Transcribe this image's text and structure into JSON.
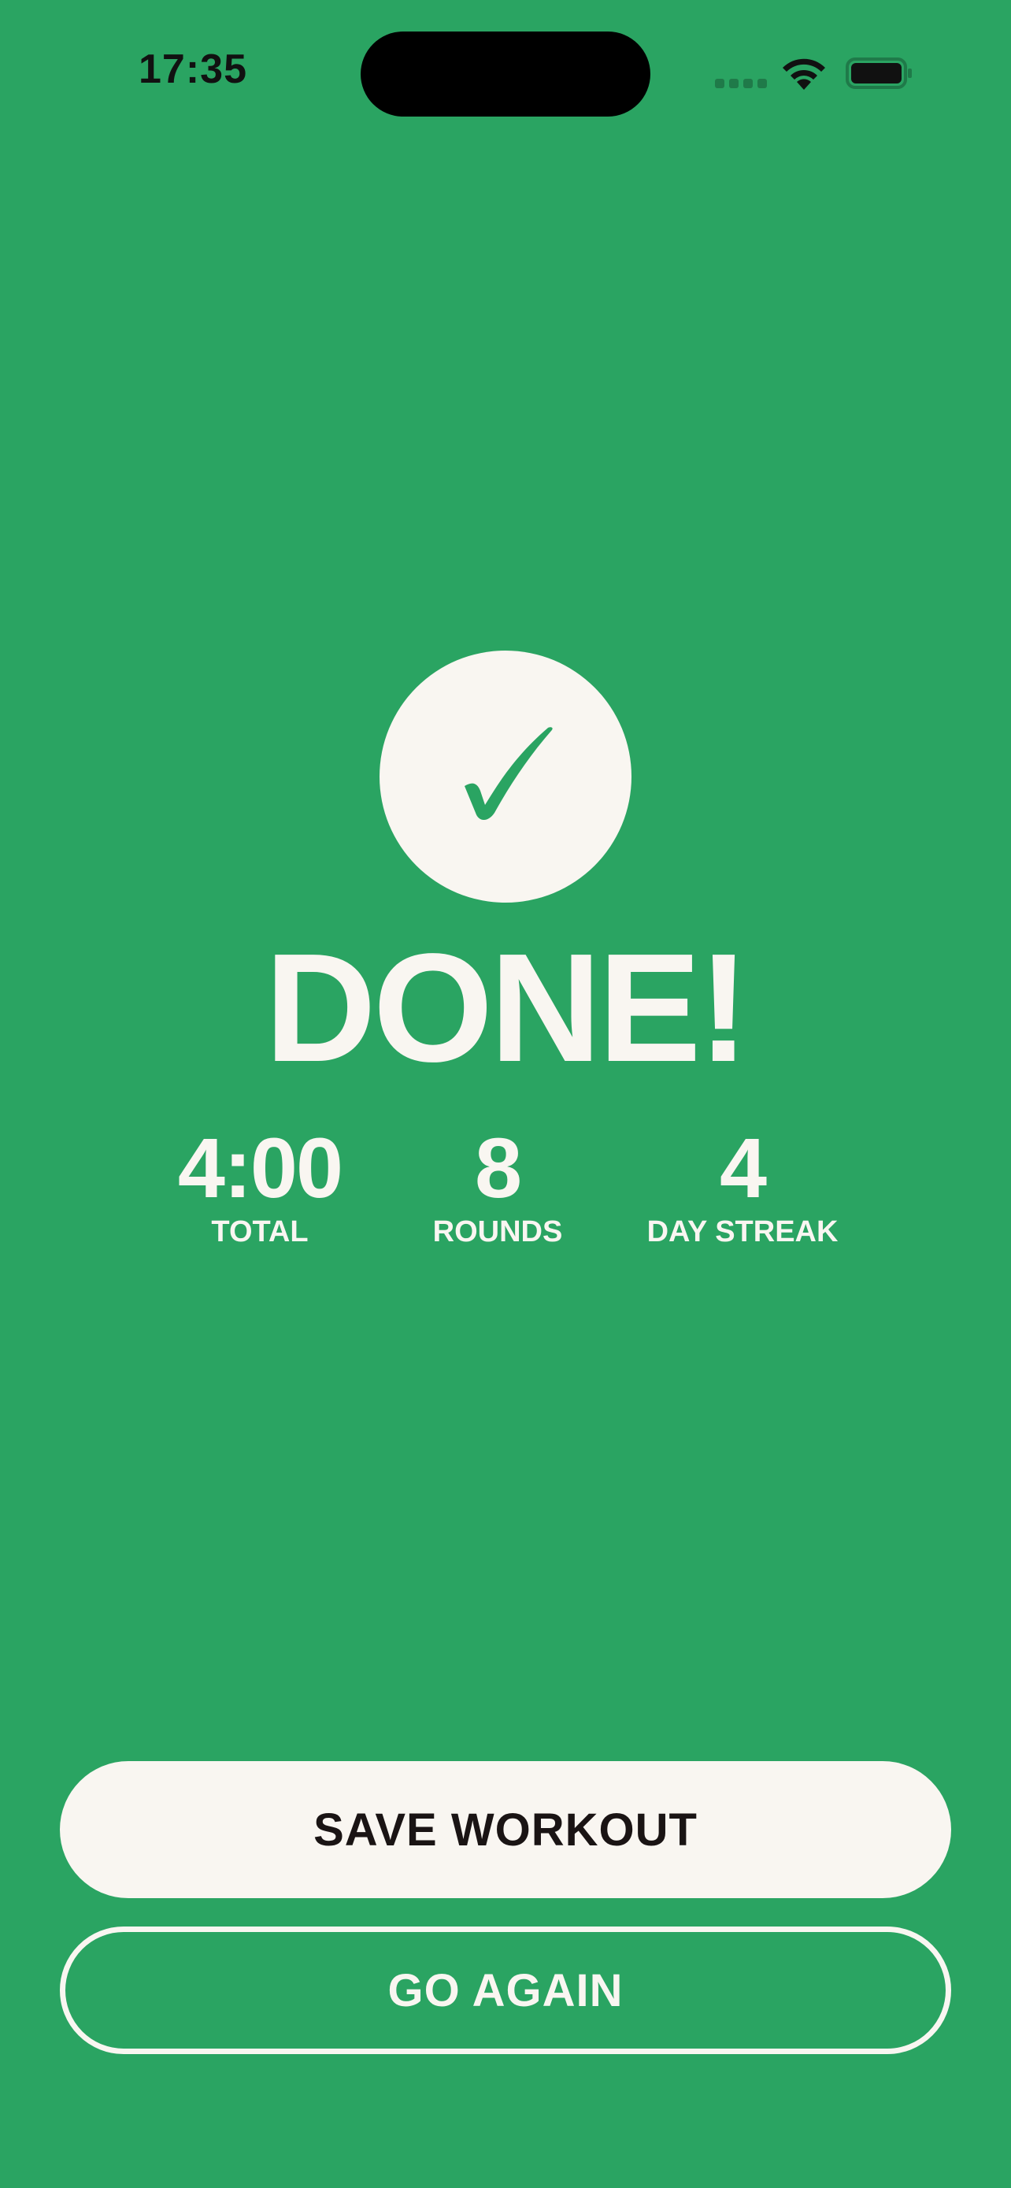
{
  "status_bar": {
    "time": "17:35",
    "icons": [
      "cellular-signal-icon",
      "wifi-icon",
      "battery-icon"
    ]
  },
  "completion": {
    "icon": "checkmark-icon",
    "title": "DONE!"
  },
  "stats": [
    {
      "value": "4:00",
      "label": "TOTAL"
    },
    {
      "value": "8",
      "label": "ROUNDS"
    },
    {
      "value": "4",
      "label": "DAY STREAK"
    }
  ],
  "actions": {
    "save_label": "SAVE WORKOUT",
    "again_label": "GO AGAIN"
  },
  "colors": {
    "background": "#2aa462",
    "foreground": "#f9f6f1",
    "button_text_dark": "#1a1414"
  }
}
